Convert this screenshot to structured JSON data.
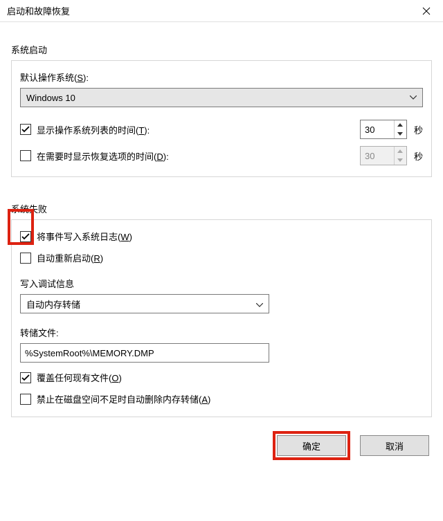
{
  "window": {
    "title": "启动和故障恢复"
  },
  "startup": {
    "group_label": "系统启动",
    "default_os_label": "默认操作系统(",
    "default_os_key": "S",
    "default_os_suffix": "):",
    "default_os_value": "Windows 10",
    "show_list_checked": true,
    "show_list_label": "显示操作系统列表的时间(",
    "show_list_key": "T",
    "show_list_suffix": "):",
    "show_list_seconds": "30",
    "show_recovery_checked": false,
    "show_recovery_label": "在需要时显示恢复选项的时间(",
    "show_recovery_key": "D",
    "show_recovery_suffix": "):",
    "show_recovery_seconds": "30",
    "seconds_unit": "秒"
  },
  "failure": {
    "group_label": "系统失败",
    "write_log_checked": true,
    "write_log_label": "将事件写入系统日志(",
    "write_log_key": "W",
    "write_log_suffix": ")",
    "auto_restart_checked": false,
    "auto_restart_label": "自动重新启动(",
    "auto_restart_key": "R",
    "auto_restart_suffix": ")",
    "debug_info_label": "写入调试信息",
    "debug_info_value": "自动内存转储",
    "dump_file_label": "转储文件:",
    "dump_file_value": "%SystemRoot%\\MEMORY.DMP",
    "overwrite_checked": true,
    "overwrite_label": "覆盖任何现有文件(",
    "overwrite_key": "O",
    "overwrite_suffix": ")",
    "no_delete_checked": false,
    "no_delete_label": "禁止在磁盘空间不足时自动删除内存转储(",
    "no_delete_key": "A",
    "no_delete_suffix": ")"
  },
  "buttons": {
    "ok": "确定",
    "cancel": "取消"
  }
}
